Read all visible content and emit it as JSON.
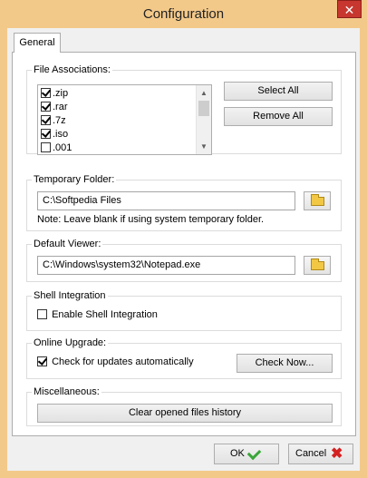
{
  "window": {
    "title": "Configuration",
    "close_glyph": "✕"
  },
  "tabs": [
    {
      "label": "General",
      "selected": true
    }
  ],
  "file_associations": {
    "legend": "File Associations:",
    "items": [
      {
        "label": ".zip",
        "checked": true
      },
      {
        "label": ".rar",
        "checked": true
      },
      {
        "label": ".7z",
        "checked": true
      },
      {
        "label": ".iso",
        "checked": true
      },
      {
        "label": ".001",
        "checked": false
      }
    ],
    "scroll_up_glyph": "▲",
    "scroll_down_glyph": "▼",
    "select_all_label": "Select All",
    "remove_all_label": "Remove All"
  },
  "temporary_folder": {
    "legend": "Temporary Folder:",
    "value": "C:\\Softpedia Files",
    "note": "Note: Leave blank if using system temporary folder."
  },
  "default_viewer": {
    "legend": "Default Viewer:",
    "value": "C:\\Windows\\system32\\Notepad.exe"
  },
  "shell_integration": {
    "legend": "Shell Integration",
    "checkbox_label": "Enable Shell Integration",
    "checked": false
  },
  "online_upgrade": {
    "legend": "Online Upgrade:",
    "checkbox_label": "Check for updates automatically",
    "checked": true,
    "check_now_label": "Check Now..."
  },
  "miscellaneous": {
    "legend": "Miscellaneous:",
    "clear_history_label": "Clear opened files history"
  },
  "footer": {
    "ok_label": "OK",
    "cancel_label": "Cancel",
    "cancel_glyph": "✖"
  },
  "icons": {
    "folder": "folder-icon",
    "ok": "checkmark-icon",
    "cancel": "red-x-icon",
    "close": "close-icon"
  },
  "colors": {
    "window_frame": "#f3c98a",
    "close_button": "#c7372f",
    "ok_check": "#3aa63a",
    "cancel_x": "#d42020"
  }
}
